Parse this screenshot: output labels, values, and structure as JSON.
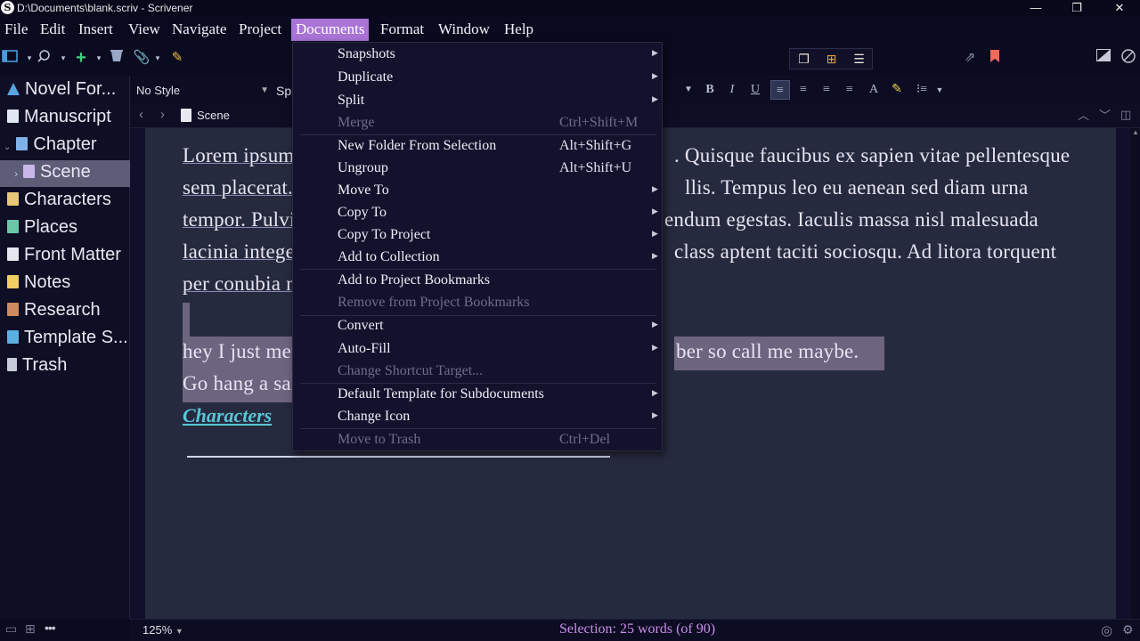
{
  "window": {
    "app_icon": "S",
    "title": "D:\\Documents\\blank.scriv - Scrivener",
    "minimize": "—",
    "restore": "❐",
    "close": "✕"
  },
  "menubar": {
    "items": [
      "File",
      "Edit",
      "Insert",
      "View",
      "Navigate",
      "Project",
      "Documents",
      "Format",
      "Window",
      "Help"
    ],
    "active": "Documents"
  },
  "toolbar": {
    "icons": [
      "layout-icon",
      "search-icon",
      "add-icon",
      "trash-icon",
      "attach-icon",
      "edit-icon"
    ],
    "view_modes": [
      "scrivenings-icon",
      "corkboard-icon",
      "outliner-icon"
    ]
  },
  "binder": {
    "items": [
      {
        "label": "Novel For...",
        "icon": "project-icon"
      },
      {
        "label": "Manuscript",
        "icon": "manuscript-icon"
      },
      {
        "label": "Chapter",
        "icon": "chapter-icon"
      },
      {
        "label": "Scene",
        "icon": "scene-icon"
      },
      {
        "label": "Characters",
        "icon": "characters-icon"
      },
      {
        "label": "Places",
        "icon": "places-icon"
      },
      {
        "label": "Front Matter",
        "icon": "front-matter-icon"
      },
      {
        "label": "Notes",
        "icon": "notes-icon"
      },
      {
        "label": "Research",
        "icon": "research-icon"
      },
      {
        "label": "Template S...",
        "icon": "template-icon"
      },
      {
        "label": "Trash",
        "icon": "trash-icon"
      }
    ],
    "selected": "Scene",
    "footer_more": "•••"
  },
  "formatbar": {
    "style": "No Style",
    "font": "Sp"
  },
  "editor_header": {
    "back": "‹",
    "forward": "›",
    "doc_title": "Scene"
  },
  "editor": {
    "lines": [
      "Lorem ipsum",
      "sem placerat.",
      "tempor. Pulvi",
      "lacinia integer",
      "per conubia n"
    ],
    "right_lines": [
      ". Quisque faucibus ex sapien vitae pellentesque",
      "llis. Tempus leo eu aenean sed diam urna",
      "endum egestas. Iaculis massa nisl malesuada",
      "class aptent taciti sociosqu. Ad litora torquent",
      ""
    ],
    "highlight_line1_left": "hey I just met",
    "highlight_line1_right": "ber so call me maybe.",
    "highlight_line2_left": "Go hang a sal",
    "link_text": "Characters"
  },
  "statusbar": {
    "zoom": "125%",
    "selection": "Selection: 25 words (of 90)"
  },
  "documents_menu": {
    "items": [
      {
        "label": "Snapshots",
        "shortcut": "",
        "submenu": true,
        "disabled": false
      },
      {
        "label": "Duplicate",
        "shortcut": "",
        "submenu": true,
        "disabled": false
      },
      {
        "label": "Split",
        "shortcut": "",
        "submenu": true,
        "disabled": false
      },
      {
        "label": "Merge",
        "shortcut": "Ctrl+Shift+M",
        "submenu": false,
        "disabled": true
      },
      {
        "label": "New Folder From Selection",
        "shortcut": "Alt+Shift+G",
        "submenu": false,
        "disabled": false
      },
      {
        "label": "Ungroup",
        "shortcut": "Alt+Shift+U",
        "submenu": false,
        "disabled": false
      },
      {
        "label": "Move To",
        "shortcut": "",
        "submenu": true,
        "disabled": false
      },
      {
        "label": "Copy To",
        "shortcut": "",
        "submenu": true,
        "disabled": false
      },
      {
        "label": "Copy To Project",
        "shortcut": "",
        "submenu": true,
        "disabled": false
      },
      {
        "label": "Add to Collection",
        "shortcut": "",
        "submenu": true,
        "disabled": false
      },
      {
        "label": "Add to Project Bookmarks",
        "shortcut": "",
        "submenu": false,
        "disabled": false
      },
      {
        "label": "Remove from Project Bookmarks",
        "shortcut": "",
        "submenu": false,
        "disabled": true
      },
      {
        "label": "Convert",
        "shortcut": "",
        "submenu": true,
        "disabled": false
      },
      {
        "label": "Auto-Fill",
        "shortcut": "",
        "submenu": true,
        "disabled": false
      },
      {
        "label": "Change Shortcut Target...",
        "shortcut": "",
        "submenu": false,
        "disabled": true
      },
      {
        "label": "Default Template for Subdocuments",
        "shortcut": "",
        "submenu": true,
        "disabled": false
      },
      {
        "label": "Change Icon",
        "shortcut": "",
        "submenu": true,
        "disabled": false
      },
      {
        "label": "Move to Trash",
        "shortcut": "Ctrl+Del",
        "submenu": false,
        "disabled": true
      }
    ]
  },
  "colors": {
    "accent": "#a974d6",
    "selection_highlight": "#6d6480",
    "link": "#58c6d6",
    "status_text": "#c98ee8"
  }
}
